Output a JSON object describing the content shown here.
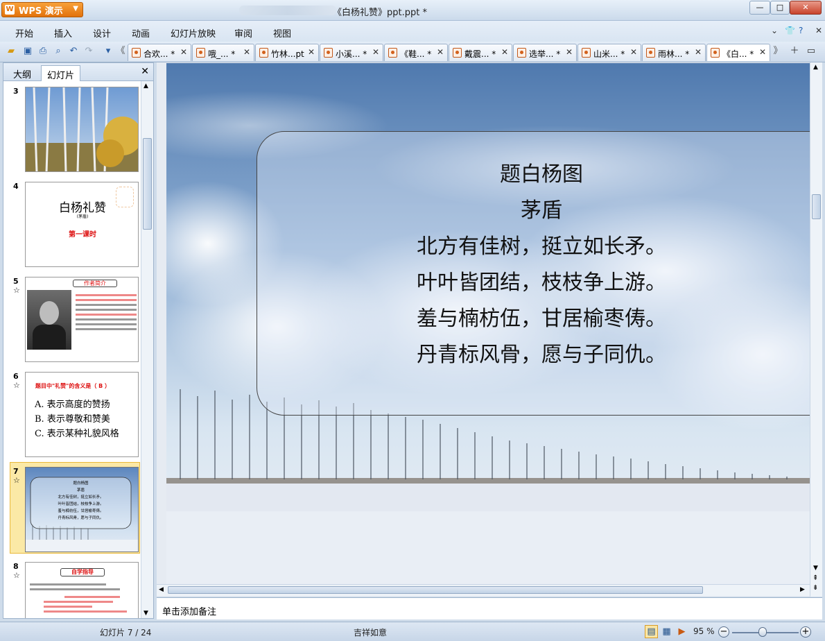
{
  "app": {
    "name": "WPS 演示",
    "window_title": "《白杨礼赞》ppt.ppt *"
  },
  "menu": [
    "开始",
    "插入",
    "设计",
    "动画",
    "幻灯片放映",
    "审阅",
    "视图"
  ],
  "doc_tabs": [
    "合欢... *",
    "哦_... *",
    "竹林...pt",
    "小溪... *",
    "《鞋... *",
    "戴震... *",
    "选举... *",
    "山米... *",
    "雨林... *",
    "《白... *"
  ],
  "left_pane": {
    "tabs": [
      "大纲",
      "幻灯片"
    ],
    "active_tab": "幻灯片",
    "slides": [
      {
        "num": "3",
        "star": ""
      },
      {
        "num": "4",
        "star": "",
        "title": "白杨礼赞",
        "subtitle": "第一课时",
        "small": "(茅盾)"
      },
      {
        "num": "5",
        "star": "☆",
        "heading": "作者简介"
      },
      {
        "num": "6",
        "star": "☆",
        "question": "题目中\"礼赞\"的含义是（ B ）",
        "options": [
          "A. 表示高度的赞扬",
          "B. 表示尊敬和赞美",
          "C. 表示某种礼貌风格"
        ]
      },
      {
        "num": "7",
        "star": "☆",
        "selected": true
      },
      {
        "num": "8",
        "star": "☆",
        "heading": "自学指导"
      }
    ]
  },
  "slide": {
    "lines": [
      "题白杨图",
      "茅盾",
      "北方有佳树，挺立如长矛。",
      "叶叶皆团结，枝枝争上游。",
      "羞与楠枋伍，甘居榆枣俦。",
      "丹青标风骨，愿与子同仇。"
    ]
  },
  "notes_placeholder": "单击添加备注",
  "status": {
    "slide_counter": "幻灯片 7 / 24",
    "theme": "吉祥如意",
    "zoom": "95 %"
  },
  "colors": {
    "accent": "#e2720c",
    "chrome": "#d9e5f2",
    "selection": "#fbe9a6"
  }
}
